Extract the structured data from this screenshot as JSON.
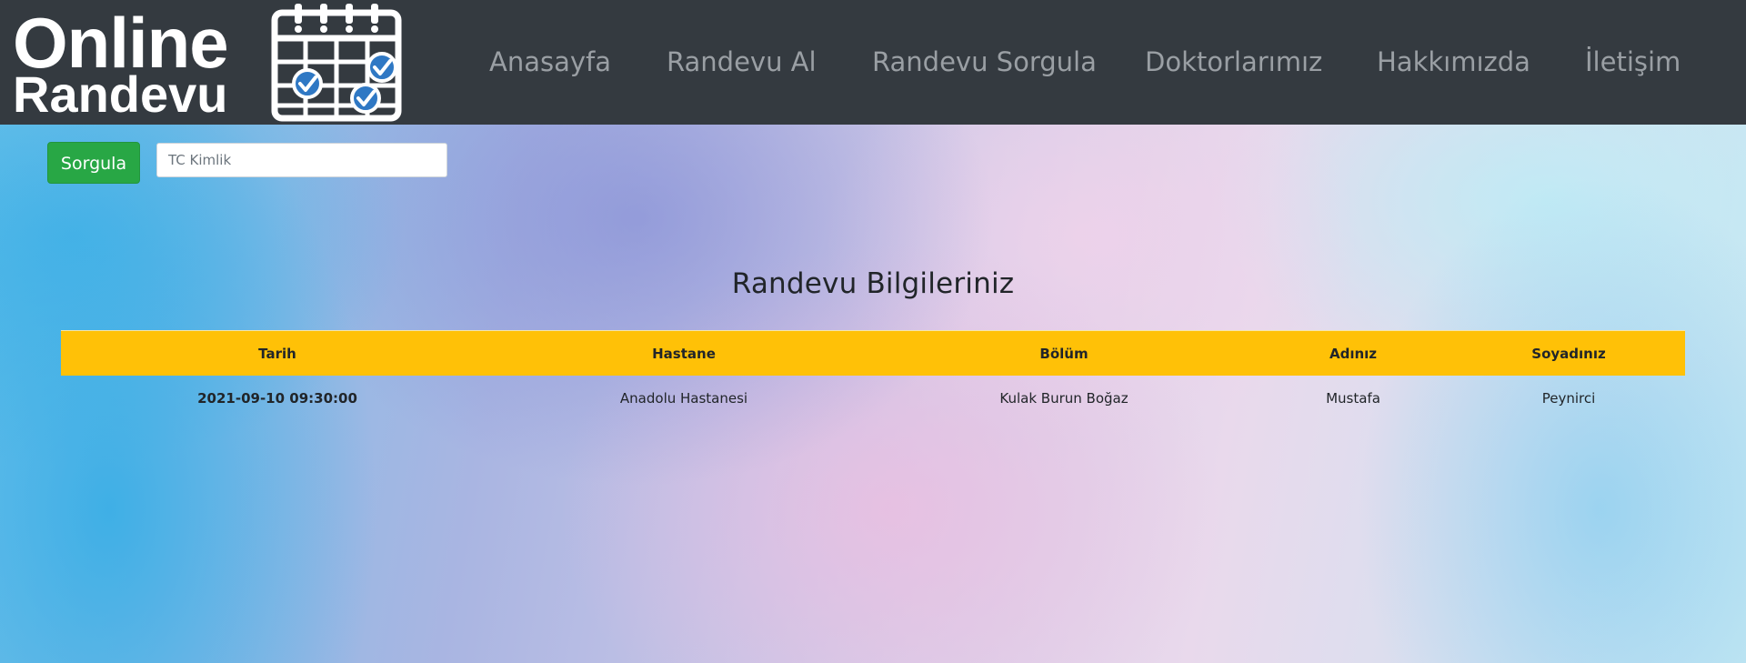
{
  "brand": {
    "line1": "Online",
    "line2": "Randevu",
    "icon": "calendar-check-icon"
  },
  "nav": {
    "items": [
      {
        "label": "Anasayfa"
      },
      {
        "label": "Randevu Al"
      },
      {
        "label": "Randevu Sorgula"
      },
      {
        "label": "Doktorlarımız"
      },
      {
        "label": "Hakkımızda"
      },
      {
        "label": "İletişim"
      }
    ]
  },
  "search": {
    "button_label": "Sorgula",
    "value": "",
    "placeholder": "TC Kimlik"
  },
  "results": {
    "title": "Randevu Bilgileriniz",
    "columns": [
      "Tarih",
      "Hastane",
      "Bölüm",
      "Adınız",
      "Soyadınız"
    ],
    "rows": [
      [
        "2021-09-10 09:30:00",
        "Anadolu Hastanesi",
        "Kulak Burun Boğaz",
        "Mustafa",
        "Peynirci"
      ]
    ]
  },
  "colors": {
    "navbar": "#343a40",
    "nav_text": "#9a9fa4",
    "button": "#28a745",
    "table_header": "#ffc107"
  }
}
